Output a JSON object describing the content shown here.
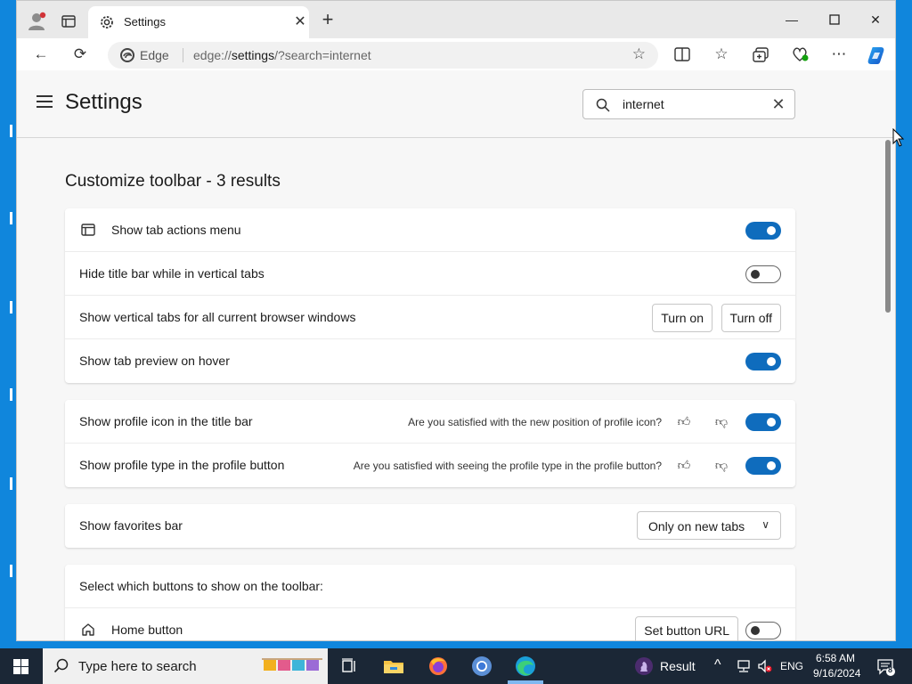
{
  "browser": {
    "tab_title": "Settings",
    "address_brand": "Edge",
    "url_prefix": "edge://",
    "url_host": "settings",
    "url_rest": "/?search=internet"
  },
  "settings": {
    "title": "Settings",
    "search_value": "internet",
    "results_heading": "Customize toolbar - 3 results",
    "group1": [
      {
        "label": "Show tab actions menu",
        "toggle": "on"
      },
      {
        "label": "Hide title bar while in vertical tabs",
        "toggle": "off"
      },
      {
        "label": "Show vertical tabs for all current browser windows",
        "turn_on": "Turn on",
        "turn_off": "Turn off"
      },
      {
        "label": "Show tab preview on hover",
        "toggle": "on"
      }
    ],
    "group2": [
      {
        "label": "Show profile icon in the title bar",
        "question": "Are you satisfied with the new position of profile icon?",
        "toggle": "on"
      },
      {
        "label": "Show profile type in the profile button",
        "question": "Are you satisfied with seeing the profile type in the profile button?",
        "toggle": "on"
      }
    ],
    "favorites": {
      "label": "Show favorites bar",
      "value": "Only on new tabs"
    },
    "toolbar_buttons": {
      "header": "Select which buttons to show on the toolbar:",
      "home": {
        "label": "Home button",
        "set_url": "Set button URL",
        "toggle": "off"
      }
    }
  },
  "taskbar": {
    "search_placeholder": "Type here to search",
    "result_label": "Result",
    "lang": "ENG",
    "time": "6:58 AM",
    "date": "9/16/2024",
    "notif_count": "8"
  },
  "colors": {
    "accent": "#0f6cbd",
    "taskbar": "#1b2736",
    "desktop": "#1086dc"
  }
}
